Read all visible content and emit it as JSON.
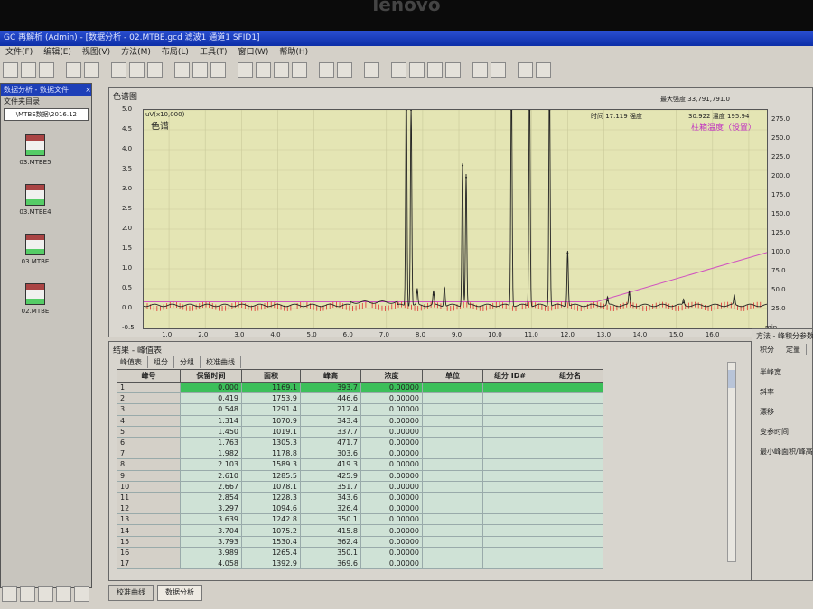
{
  "bezel_brand": "lenovo",
  "window": {
    "title": "GC 再解析 (Admin) - [数据分析 - 02.MTBE.gcd 滤波1 通道1 SFID1]"
  },
  "menu": [
    "文件(F)",
    "编辑(E)",
    "视图(V)",
    "方法(M)",
    "布局(L)",
    "工具(T)",
    "窗口(W)",
    "帮助(H)"
  ],
  "left_panel": {
    "title": "数据分析 - 数据文件",
    "folder_label": "文件夹目录",
    "folder_path": "\\MTBE数据\\2016.12",
    "files": [
      "03.MTBE5",
      "03.MTBE4",
      "03.MTBE",
      "02.MTBE"
    ]
  },
  "chart_panel": {
    "title": "色谱图",
    "chart_label": "色谱",
    "y_unit": "uV(x10,000)",
    "max_intensity": "最大强度 33,791,791.0",
    "cursor": "时间 17.119 强度",
    "cursor_values": "30.922 温度 195.94",
    "temp_label": "柱箱温度（设置）",
    "x_unit": "min"
  },
  "chart_data": {
    "type": "line",
    "xlim": [
      0.3,
      17.5
    ],
    "ylim": [
      -0.5,
      5.0
    ],
    "y2lim": [
      0,
      287.5
    ],
    "x_ticks": [
      "1.0",
      "2.0",
      "3.0",
      "4.0",
      "5.0",
      "6.0",
      "7.0",
      "8.0",
      "9.0",
      "10.0",
      "11.0",
      "12.0",
      "13.0",
      "14.0",
      "15.0",
      "16.0"
    ],
    "y_ticks": [
      "5.0",
      "4.5",
      "4.0",
      "3.5",
      "3.0",
      "2.5",
      "2.0",
      "1.5",
      "1.0",
      "0.5",
      "0.0",
      "-0.5"
    ],
    "y2_ticks": [
      "275.0",
      "250.0",
      "225.0",
      "200.0",
      "175.0",
      "150.0",
      "125.0",
      "100.0",
      "75.0",
      "50.0",
      "25.0"
    ],
    "peaks": [
      [
        7.55,
        6.0
      ],
      [
        7.68,
        5.2
      ],
      [
        7.85,
        0.4
      ],
      [
        8.3,
        0.35
      ],
      [
        8.6,
        0.5
      ],
      [
        9.1,
        3.6
      ],
      [
        9.2,
        3.3
      ],
      [
        10.45,
        6
      ],
      [
        10.95,
        6
      ],
      [
        11.5,
        6
      ],
      [
        12.0,
        1.4
      ],
      [
        13.1,
        0.2
      ],
      [
        13.7,
        0.35
      ],
      [
        15.2,
        0.15
      ],
      [
        16.6,
        0.25
      ]
    ],
    "temperature": [
      [
        0.3,
        35
      ],
      [
        12.8,
        35
      ],
      [
        17.5,
        100
      ]
    ]
  },
  "results": {
    "title": "结果 - 峰值表",
    "tabs": [
      "峰值表",
      "组分",
      "分组",
      "校准曲线"
    ],
    "columns": [
      "峰号",
      "保留时间",
      "面积",
      "峰高",
      "浓度",
      "单位",
      "组分 ID#",
      "组分名"
    ],
    "rows": [
      [
        "1",
        "0.000",
        "1169.1",
        "393.7",
        "0.00000"
      ],
      [
        "2",
        "0.419",
        "1753.9",
        "446.6",
        "0.00000"
      ],
      [
        "3",
        "0.548",
        "1291.4",
        "212.4",
        "0.00000"
      ],
      [
        "4",
        "1.314",
        "1070.9",
        "343.4",
        "0.00000"
      ],
      [
        "5",
        "1.450",
        "1019.1",
        "337.7",
        "0.00000"
      ],
      [
        "6",
        "1.763",
        "1305.3",
        "471.7",
        "0.00000"
      ],
      [
        "7",
        "1.982",
        "1178.8",
        "303.6",
        "0.00000"
      ],
      [
        "8",
        "2.103",
        "1589.3",
        "419.3",
        "0.00000"
      ],
      [
        "9",
        "2.610",
        "1285.5",
        "425.9",
        "0.00000"
      ],
      [
        "10",
        "2.667",
        "1078.1",
        "351.7",
        "0.00000"
      ],
      [
        "11",
        "2.854",
        "1228.3",
        "343.6",
        "0.00000"
      ],
      [
        "12",
        "3.297",
        "1094.6",
        "326.4",
        "0.00000"
      ],
      [
        "13",
        "3.639",
        "1242.8",
        "350.1",
        "0.00000"
      ],
      [
        "14",
        "3.704",
        "1075.2",
        "415.8",
        "0.00000"
      ],
      [
        "15",
        "3.793",
        "1530.4",
        "362.4",
        "0.00000"
      ],
      [
        "16",
        "3.989",
        "1265.4",
        "350.1",
        "0.00000"
      ],
      [
        "17",
        "4.058",
        "1392.9",
        "369.6",
        "0.00000"
      ]
    ]
  },
  "method_panel": {
    "title": "方法 - 峰积分参数",
    "tabs": [
      "积分",
      "定量"
    ],
    "labels": [
      "半峰宽",
      "斜率",
      "漂移",
      "变参时间",
      "最小峰面积/峰高"
    ]
  },
  "bottom_tabs": [
    "校准曲线",
    "数据分析"
  ]
}
